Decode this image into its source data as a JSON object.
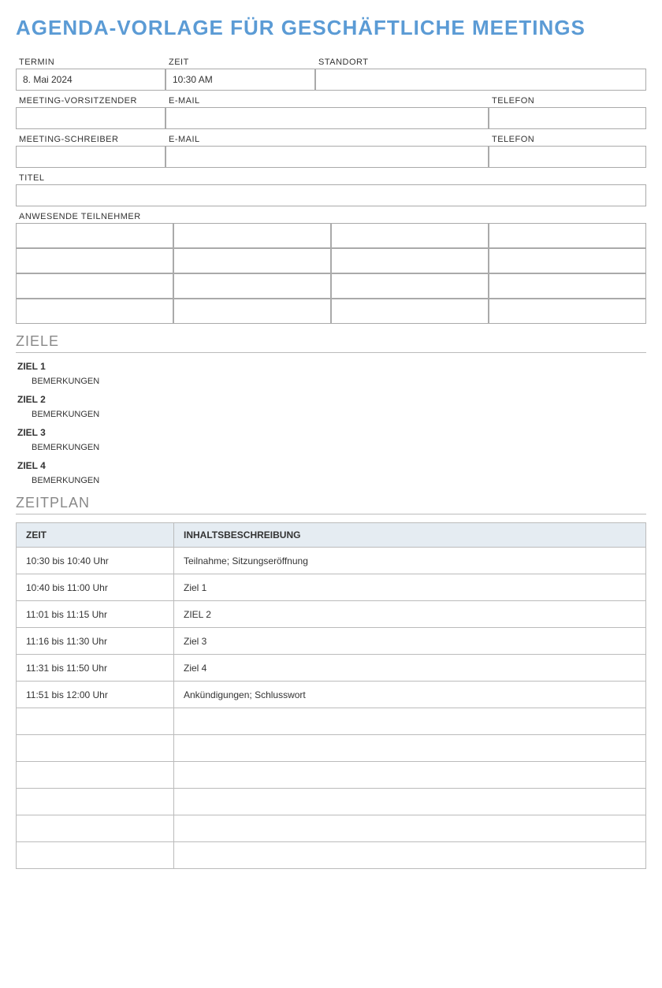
{
  "title": "AGENDA-VORLAGE FÜR GESCHÄFTLICHE MEETINGS",
  "row1": {
    "labels": {
      "date": "TERMIN",
      "time": "ZEIT",
      "location": "STANDORT"
    },
    "values": {
      "date": "8. Mai 2024",
      "time": "10:30 AM",
      "location": ""
    }
  },
  "row2": {
    "labels": {
      "chair": "MEETING-VORSITZENDER",
      "email": "E-MAIL",
      "phone": "TELEFON"
    },
    "values": {
      "chair": "",
      "email": "",
      "phone": ""
    }
  },
  "row3": {
    "labels": {
      "scribe": "MEETING-SCHREIBER",
      "email": "E-MAIL",
      "phone": "TELEFON"
    },
    "values": {
      "scribe": "",
      "email": "",
      "phone": ""
    }
  },
  "row4": {
    "label": "TITEL",
    "value": ""
  },
  "attendees": {
    "label": "ANWESENDE TEILNEHMER"
  },
  "sections": {
    "goals": "ZIELE",
    "schedule": "ZEITPLAN"
  },
  "goals": [
    {
      "title": "ZIEL 1",
      "remark": "BEMERKUNGEN"
    },
    {
      "title": "ZIEL 2",
      "remark": "BEMERKUNGEN"
    },
    {
      "title": "ZIEL 3",
      "remark": "BEMERKUNGEN"
    },
    {
      "title": "ZIEL 4",
      "remark": "BEMERKUNGEN"
    }
  ],
  "schedule": {
    "headers": {
      "time": "ZEIT",
      "desc": "INHALTSBESCHREIBUNG"
    },
    "rows": [
      {
        "time": "10:30 bis 10:40 Uhr",
        "desc": "Teilnahme; Sitzungseröffnung"
      },
      {
        "time": "10:40 bis 11:00 Uhr",
        "desc": "Ziel 1"
      },
      {
        "time": "11:01 bis 11:15 Uhr",
        "desc": "ZIEL 2"
      },
      {
        "time": "11:16 bis 11:30 Uhr",
        "desc": "Ziel 3"
      },
      {
        "time": "11:31 bis 11:50 Uhr",
        "desc": "Ziel 4"
      },
      {
        "time": "11:51 bis 12:00 Uhr",
        "desc": "Ankündigungen; Schlusswort"
      },
      {
        "time": "",
        "desc": ""
      },
      {
        "time": "",
        "desc": ""
      },
      {
        "time": "",
        "desc": ""
      },
      {
        "time": "",
        "desc": ""
      },
      {
        "time": "",
        "desc": ""
      },
      {
        "time": "",
        "desc": ""
      }
    ]
  }
}
